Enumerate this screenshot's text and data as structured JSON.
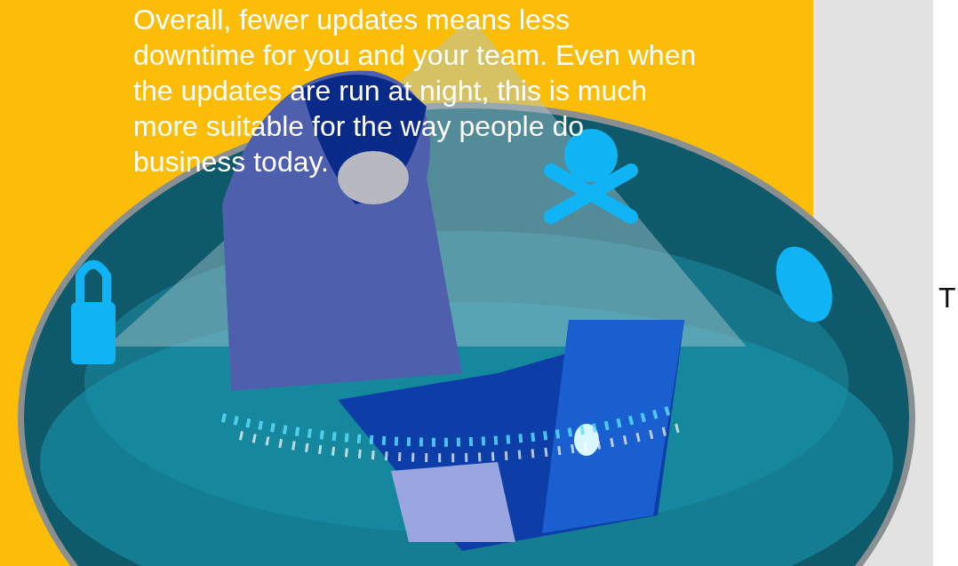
{
  "article": {
    "paragraph": "Overall, fewer updates means less downtime for you and your team. Even when the updates are run at night, this is much more suitable for the way people do business today."
  },
  "side_column": {
    "text": "T"
  }
}
